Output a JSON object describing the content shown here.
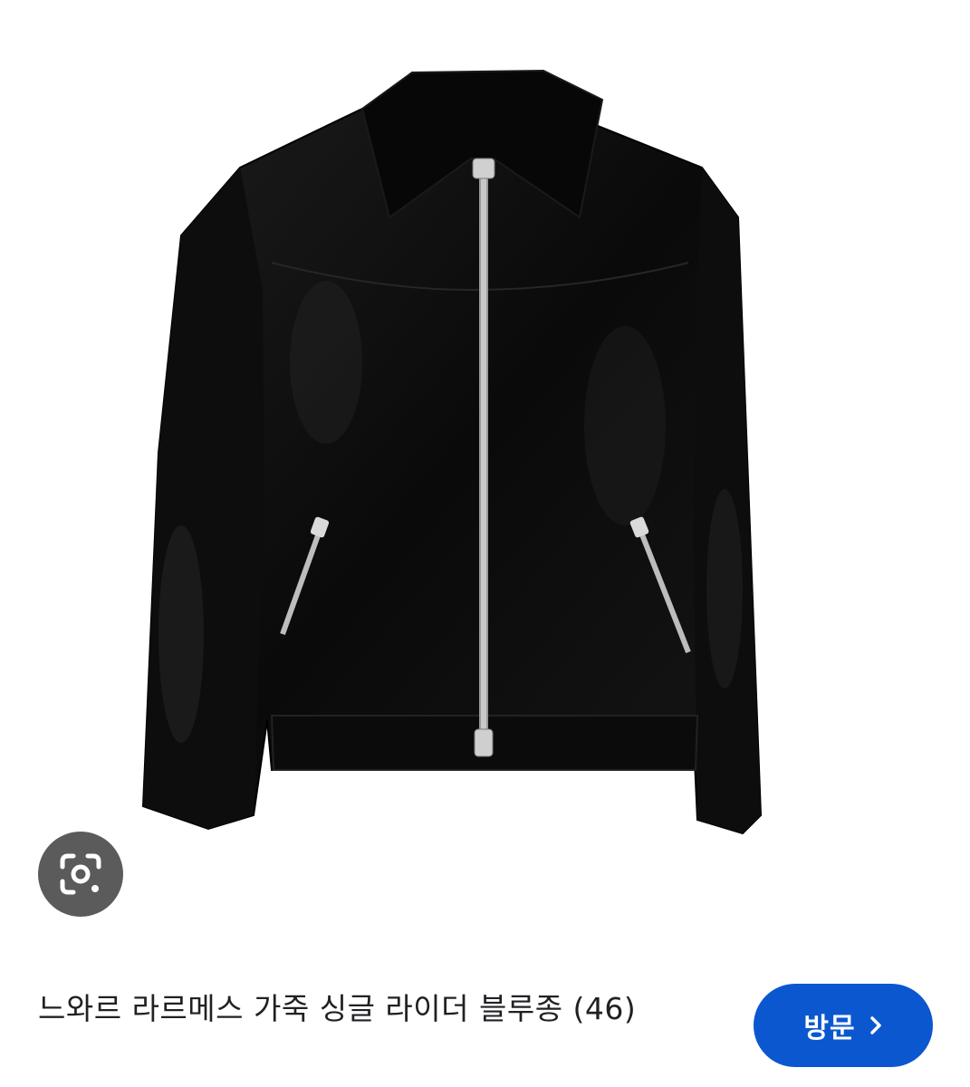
{
  "product": {
    "image_icon": "leather-jacket-photo",
    "title": "느와르 라르메스 가죽 싱글 라이더 블루종 (46)"
  },
  "lens": {
    "icon": "google-lens-icon"
  },
  "visit_button": {
    "label": "방문",
    "icon": "chevron-right-icon"
  },
  "colors": {
    "accent": "#0b57d0",
    "lens_bg": "#5b5b5b",
    "text": "#202124"
  }
}
